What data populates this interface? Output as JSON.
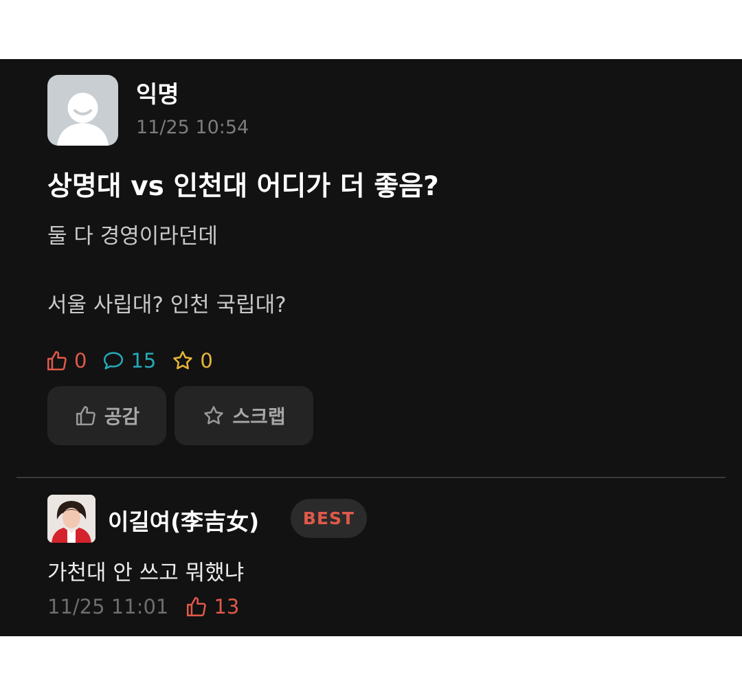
{
  "post": {
    "author": "익명",
    "time": "11/25 10:54",
    "title": "상명대 vs 인천대 어디가 더 좋음?",
    "body_lines": [
      "둘 다 경영이라던데",
      "서울 사립대? 인천 국립대?"
    ],
    "stats": {
      "likes": "0",
      "comments": "15",
      "scraps": "0"
    },
    "buttons": {
      "like_label": "공감",
      "scrap_label": "스크랩"
    },
    "icons": {
      "avatar": "default-profile-icon",
      "like": "thumbs-up-icon",
      "comment": "comment-bubble-icon",
      "scrap": "star-icon"
    }
  },
  "comment": {
    "author": "이길여(李吉女)",
    "badge": "BEST",
    "text": "가천대 안 쓰고 뭐했냐",
    "time": "11/25 11:01",
    "likes": "13"
  },
  "colors": {
    "background": "#121212",
    "like": "#e0594a",
    "comment": "#27a8b8",
    "scrap": "#e8b53a",
    "button_bg": "#242424"
  }
}
